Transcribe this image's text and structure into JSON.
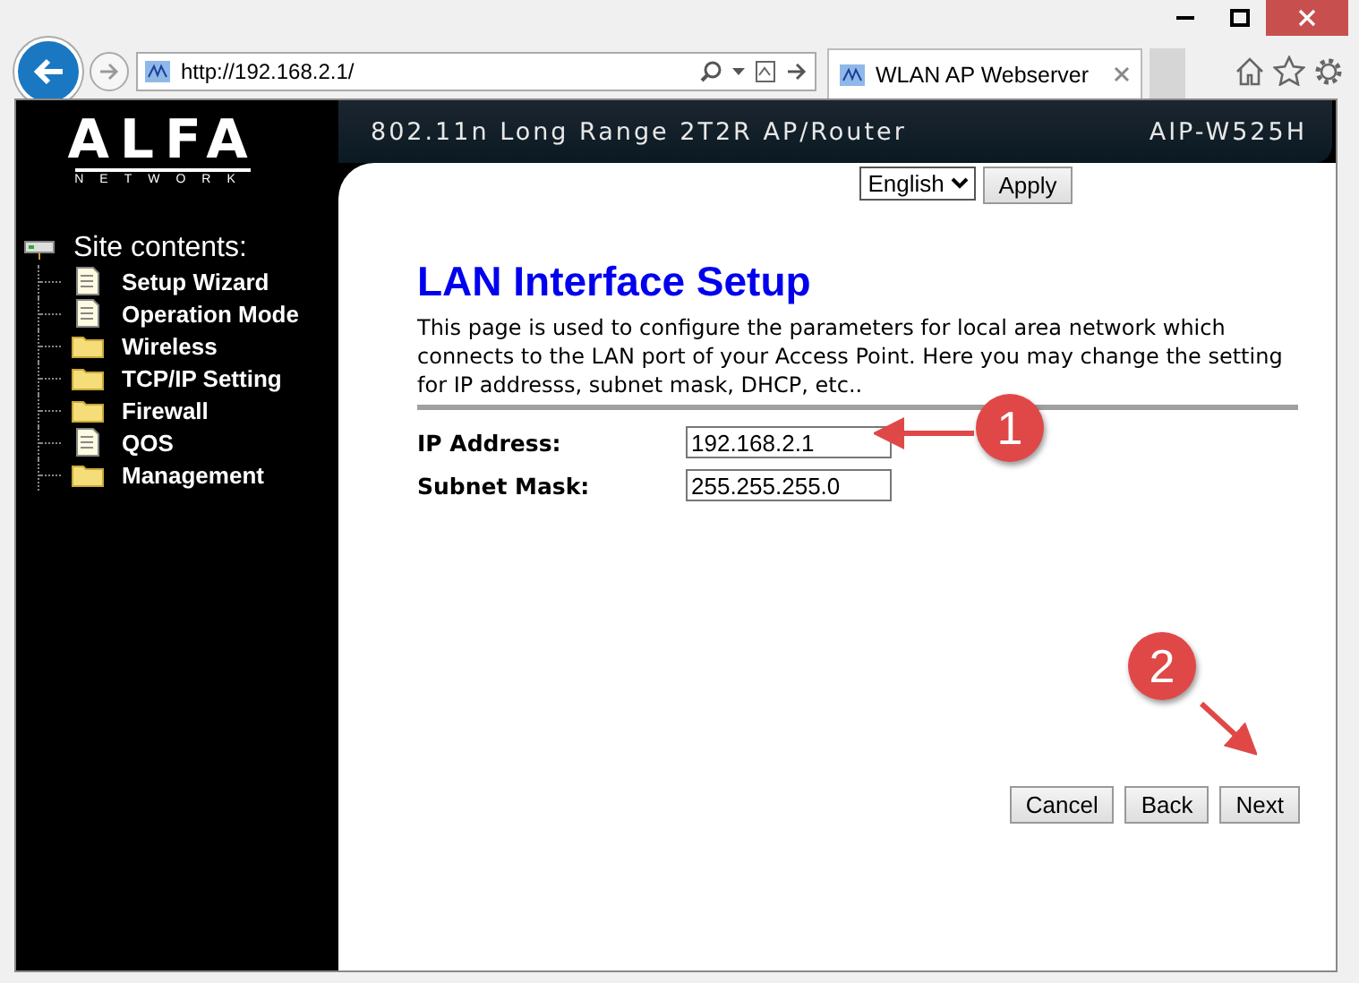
{
  "browser": {
    "address": "http://192.168.2.1/",
    "tab_title": "WLAN AP Webserver"
  },
  "banner": {
    "logo_word": "ALFA",
    "logo_sub": "NETWORK",
    "tagline": "802.11n Long Range 2T2R AP/Router",
    "model": "AIP-W525H"
  },
  "sidebar": {
    "title": "Site contents:",
    "items": [
      {
        "label": "Setup Wizard",
        "kind": "page"
      },
      {
        "label": "Operation Mode",
        "kind": "page"
      },
      {
        "label": "Wireless",
        "kind": "folder"
      },
      {
        "label": "TCP/IP Setting",
        "kind": "folder"
      },
      {
        "label": "Firewall",
        "kind": "folder"
      },
      {
        "label": "QOS",
        "kind": "page"
      },
      {
        "label": "Management",
        "kind": "folder"
      }
    ]
  },
  "language": {
    "value": "English",
    "button": "Apply"
  },
  "page": {
    "title": "LAN Interface Setup",
    "description": "This page is used to configure the parameters for local area network which connects to the LAN port of your Access Point. Here you may change the setting for IP addresss, subnet mask, DHCP, etc..",
    "fields": [
      {
        "label": "IP Address:",
        "value": "192.168.2.1"
      },
      {
        "label": "Subnet Mask:",
        "value": "255.255.255.0"
      }
    ],
    "buttons": [
      "Cancel",
      "Back",
      "Next"
    ]
  },
  "annotations": [
    {
      "number": "1"
    },
    {
      "number": "2"
    }
  ]
}
